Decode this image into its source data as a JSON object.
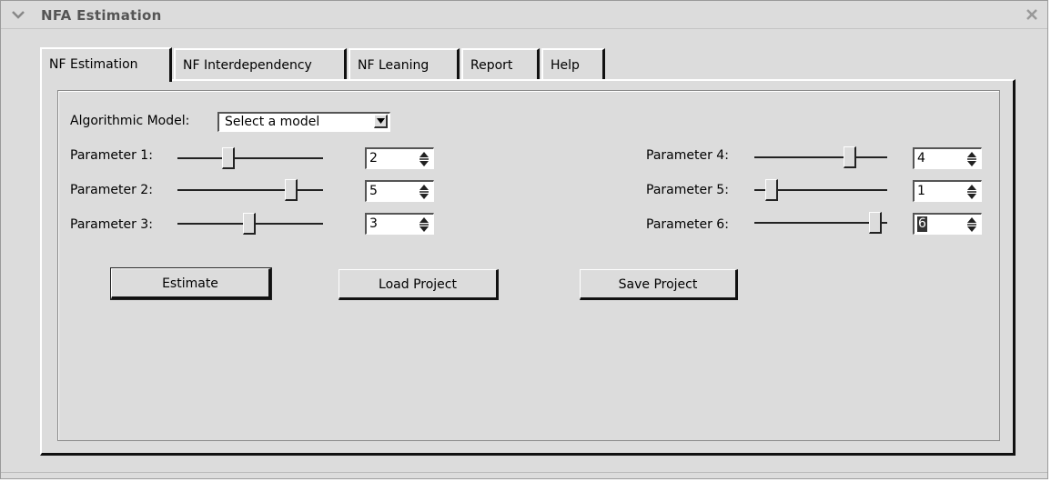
{
  "window": {
    "title": "NFA Estimation"
  },
  "tabs": [
    {
      "label": "NF Estimation",
      "active": true
    },
    {
      "label": "NF Interdependency",
      "active": false
    },
    {
      "label": "NF Leaning",
      "active": false
    },
    {
      "label": "Report",
      "active": false
    },
    {
      "label": "Help",
      "active": false
    }
  ],
  "model": {
    "label": "Algorithmic Model:",
    "selected": "Select a model"
  },
  "parameters": [
    {
      "label": "Parameter 1:",
      "value": "2",
      "slider_fraction": 0.35
    },
    {
      "label": "Parameter 2:",
      "value": "5",
      "slider_fraction": 0.78
    },
    {
      "label": "Parameter 3:",
      "value": "3",
      "slider_fraction": 0.5
    },
    {
      "label": "Parameter 4:",
      "value": "4",
      "slider_fraction": 0.74
    },
    {
      "label": "Parameter 5:",
      "value": "1",
      "slider_fraction": 0.1
    },
    {
      "label": "Parameter 6:",
      "value": "6",
      "slider_fraction": 0.88
    }
  ],
  "buttons": {
    "estimate": "Estimate",
    "load": "Load Project",
    "save": "Save Project"
  },
  "icons": {
    "title_menu": "chevron-down-icon",
    "close": "close-icon",
    "dropdown": "triangle-down-icon",
    "spinner": "spin-arrows-icon"
  }
}
